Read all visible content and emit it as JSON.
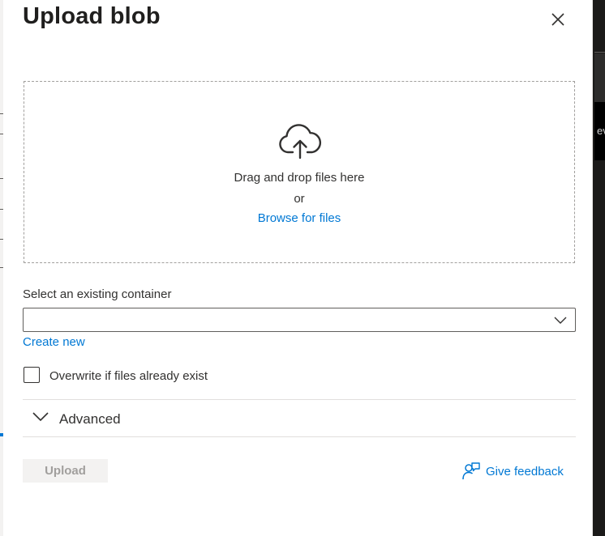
{
  "panel": {
    "title": "Upload blob",
    "close_icon": "close-icon"
  },
  "dropzone": {
    "icon": "cloud-upload-icon",
    "main_text": "Drag and drop files here",
    "or_text": "or",
    "browse_link": "Browse for files"
  },
  "container": {
    "label": "Select an existing container",
    "selected_value": "",
    "create_new_link": "Create new"
  },
  "overwrite": {
    "label": "Overwrite if files already exist",
    "checked": false
  },
  "advanced": {
    "label": "Advanced",
    "expanded": false
  },
  "footer": {
    "upload_label": "Upload",
    "upload_disabled": true,
    "feedback_label": "Give feedback"
  },
  "background": {
    "peek_text": "ev"
  },
  "colors": {
    "accent": "#0078d4",
    "text": "#323130",
    "disabled_bg": "#f3f2f1",
    "disabled_text": "#a19f9d"
  }
}
